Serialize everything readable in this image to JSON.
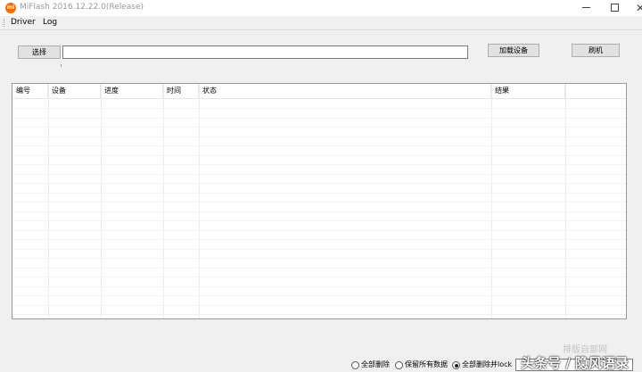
{
  "window": {
    "title": "MiFlash 2016.12.22.0(Release)",
    "icon_text": "mi",
    "controls": {
      "minimize": "minimize",
      "maximize": "maximize",
      "close": "✕"
    }
  },
  "menu": {
    "items": [
      "Driver",
      "Log"
    ]
  },
  "toolbar": {
    "select_label": "选择",
    "path_value": "",
    "load_device_label": "加载设备",
    "flash_label": "刷机"
  },
  "table": {
    "columns": [
      "编号",
      "设备",
      "进度",
      "时间",
      "状态",
      "结果",
      ""
    ],
    "rows": []
  },
  "footer": {
    "options": [
      {
        "label": "全部删除",
        "checked": false
      },
      {
        "label": "保留所有数据",
        "checked": false
      },
      {
        "label": "全部删除并lock",
        "checked": true
      }
    ],
    "combo_value": ""
  },
  "watermark": {
    "line1": "排版自部网",
    "line2": "头条号 / 隐风语录"
  },
  "colors": {
    "accent": "#ff6900",
    "window_bg": "#f0f0f0",
    "button_bg": "#e1e1e1"
  }
}
